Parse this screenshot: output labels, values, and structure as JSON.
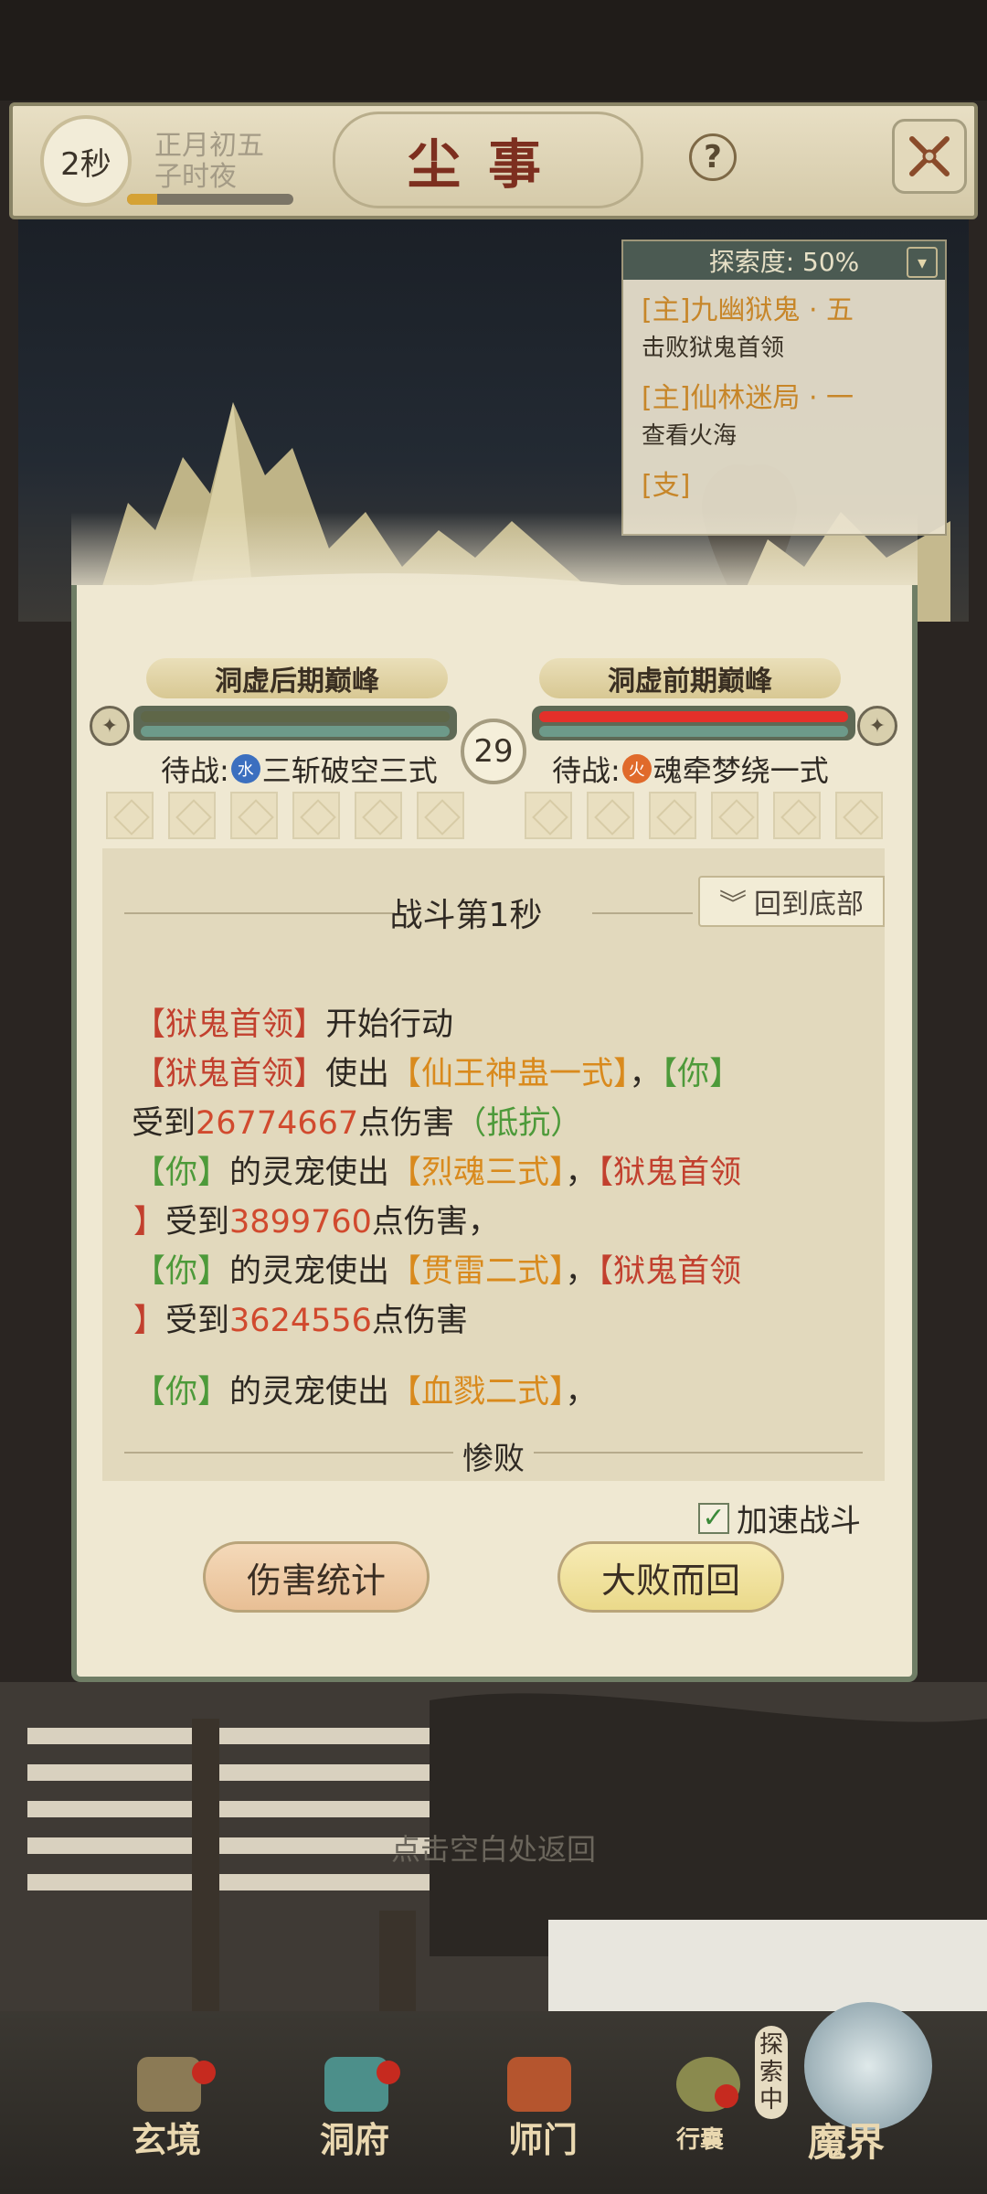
{
  "header": {
    "timer": "2秒",
    "date_line1": "正月初五",
    "date_line2": "子时夜",
    "time_progress": 0.18,
    "title": "尘事",
    "help": "?"
  },
  "explore": {
    "label": "探索度: 50%",
    "quests": [
      {
        "title": "[主]九幽狱鬼 · 五",
        "sub": "击败狱鬼首领"
      },
      {
        "title": "[主]仙林迷局 · 一",
        "sub": "查看火海"
      },
      {
        "title": "[支]",
        "sub": ""
      }
    ]
  },
  "battle": {
    "left_realm": "洞虚后期巅峰",
    "right_realm": "洞虚前期巅峰",
    "round": "29",
    "left_wait_prefix": "待战:",
    "left_element": "水",
    "left_skill": "三斩破空三式",
    "right_wait_prefix": "待战:",
    "right_element": "火",
    "right_skill": "魂牵梦绕一式",
    "left_hp": 1.0,
    "right_hp": 1.0
  },
  "log": {
    "title": "战斗第1秒",
    "scroll_bottom": "回到底部",
    "result": "惨败",
    "lines": {
      "l1_a": "【狱鬼首领】",
      "l1_b": "开始行动",
      "l2_a": "【狱鬼首领】",
      "l2_b": "使出",
      "l2_c": "【仙王神蛊一式】",
      "l2_d": "，",
      "l2_e": "【你】",
      "l3_a": "受到",
      "l3_b": "26774667",
      "l3_c": "点伤害",
      "l3_d": "（抵抗）",
      "l4_a": "【你】",
      "l4_b": "的灵宠使出",
      "l4_c": "【烈魂三式】",
      "l4_d": "，",
      "l4_e": "【狱鬼首领",
      "l5_a": "】",
      "l5_b": "受到",
      "l5_c": "3899760",
      "l5_d": "点伤害，",
      "l6_a": "【你】",
      "l6_b": "的灵宠使出",
      "l6_c": "【贯雷二式】",
      "l6_d": "，",
      "l6_e": "【狱鬼首领",
      "l7_a": "】",
      "l7_b": "受到",
      "l7_c": "3624556",
      "l7_d": "点伤害",
      "l8_a": "【你】",
      "l8_b": "的灵宠使出",
      "l8_c": "【血戮二式】",
      "l8_d": "，"
    }
  },
  "speed_toggle": {
    "label": "加速战斗",
    "checked": true
  },
  "buttons": {
    "damage_stats": "伤害统计",
    "retreat": "大败而回"
  },
  "back_hint": "点击空白处返回",
  "nav": {
    "items": [
      "玄境",
      "洞府",
      "师门",
      "行囊",
      "魔界"
    ],
    "explore_badge": "探索中"
  },
  "colors": {
    "enemy_name": "#c2402e",
    "skill": "#d98a1d",
    "player": "#4d9a3a",
    "damage": "#d14a2e"
  }
}
